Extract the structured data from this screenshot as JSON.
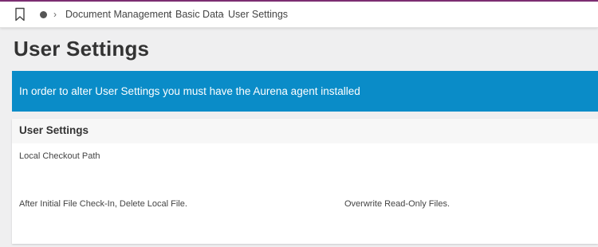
{
  "breadcrumb": {
    "items": [
      "Document Management",
      "Basic Data",
      "User Settings"
    ],
    "bookmark_icon": "bookmark-icon",
    "home_icon": "home-dot-icon",
    "separator_icon": "chevron-right-icon"
  },
  "page": {
    "title": "User Settings"
  },
  "banner": {
    "message": "In order to alter User Settings you must have the Aurena agent installed",
    "color": "#0a8cc8"
  },
  "panel": {
    "title": "User Settings",
    "fields": [
      {
        "label": "Local Checkout Path"
      },
      {
        "label": "After Initial File Check-In, Delete Local File."
      },
      {
        "label": "Overwrite Read-Only Files."
      }
    ]
  },
  "colors": {
    "accent": "#7d2e73",
    "background": "#efeff0"
  }
}
